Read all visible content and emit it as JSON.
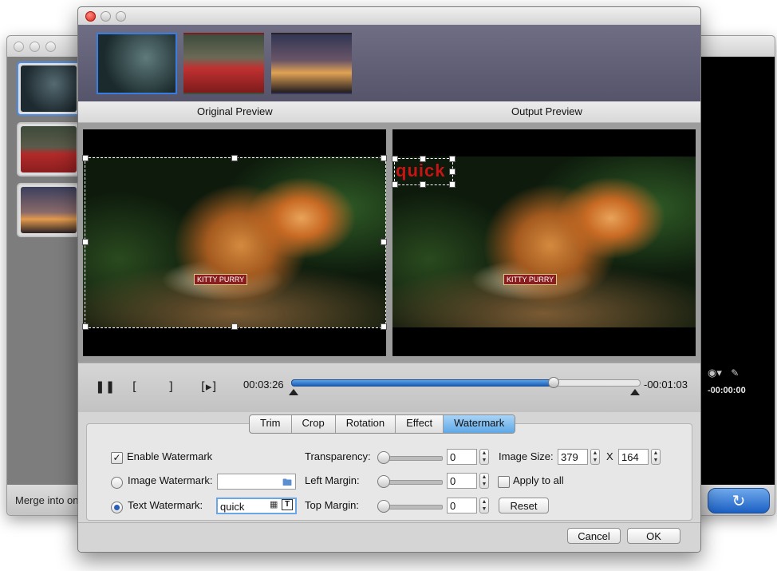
{
  "background_window": {
    "merge_label": "Merge into on",
    "timecode": "-00:00:00"
  },
  "previews": {
    "original_label": "Original Preview",
    "output_label": "Output Preview",
    "watermark_text": "quick",
    "badge_text": "KITTY PURRY"
  },
  "playback": {
    "current_time": "00:03:26",
    "remaining_time": "-00:01:03",
    "progress": 0.75
  },
  "tabs": [
    "Trim",
    "Crop",
    "Rotation",
    "Effect",
    "Watermark"
  ],
  "active_tab": "Watermark",
  "watermark": {
    "enable_label": "Enable Watermark",
    "enable_checked": true,
    "image_label": "Image Watermark:",
    "image_value": "",
    "text_label": "Text Watermark:",
    "text_value": "quick",
    "transparency_label": "Transparency:",
    "transparency_value": "0",
    "left_margin_label": "Left Margin:",
    "left_margin_value": "0",
    "top_margin_label": "Top  Margin:",
    "top_margin_value": "0",
    "image_size_label": "Image Size:",
    "image_width": "379",
    "size_separator": "X",
    "image_height": "164",
    "apply_all_label": "Apply to all",
    "reset_label": "Reset"
  },
  "footer": {
    "cancel_label": "Cancel",
    "ok_label": "OK"
  },
  "colors": {
    "accent": "#3a7de0",
    "watermark_text": "#c81414",
    "active_tab": "#6fb3ec"
  },
  "icons": [
    "pause-icon",
    "mark-in-icon",
    "mark-out-icon",
    "play-segment-icon",
    "folder-icon",
    "grid-icon",
    "text-icon",
    "camera-icon",
    "edit-icon",
    "convert-icon"
  ]
}
